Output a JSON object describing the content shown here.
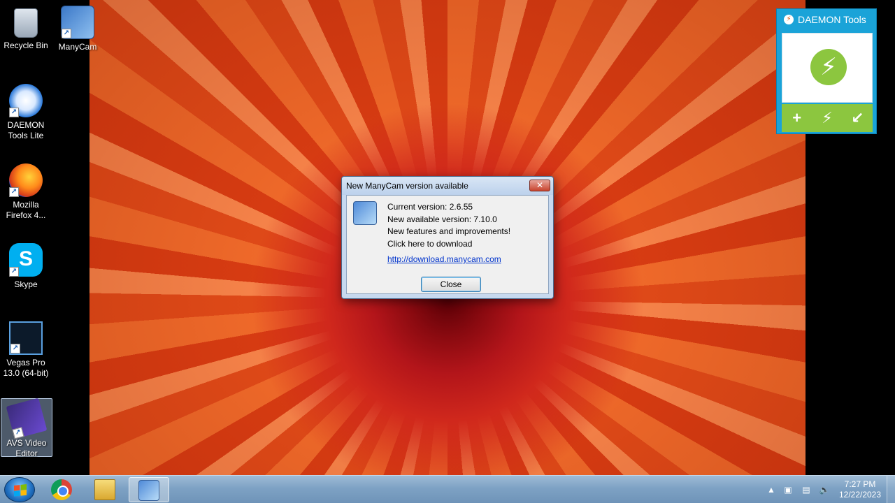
{
  "desktop": {
    "icons": [
      {
        "label": "Recycle Bin"
      },
      {
        "label": "ManyCam"
      },
      {
        "label": "DAEMON Tools Lite"
      },
      {
        "label": "Mozilla Firefox 4..."
      },
      {
        "label": "Skype"
      },
      {
        "label": "Vegas Pro 13.0 (64-bit)"
      },
      {
        "label": "AVS Video Editor"
      }
    ]
  },
  "daemon_gadget": {
    "title": "DAEMON Tools",
    "actions": [
      "+",
      "⚡",
      "↙"
    ]
  },
  "dialog": {
    "title": "New ManyCam version available",
    "close_x": "✕",
    "current_version": "Current version: 2.6.55",
    "new_version": "New available version: 7.10.0",
    "features": "New features and improvements!",
    "click_here": "Click here to download",
    "link": "http://download.manycam.com",
    "close_button": "Close"
  },
  "taskbar": {
    "apps": [
      "chrome-icon",
      "file-explorer-icon",
      "manycam-icon"
    ],
    "tray": {
      "show_hidden": "▲",
      "clock_time": "7:27 PM",
      "clock_date": "12/22/2023"
    }
  },
  "colors": {
    "daemon_accent": "#1aa3d8",
    "daemon_green": "#8cc63f",
    "link": "#0033cc"
  }
}
